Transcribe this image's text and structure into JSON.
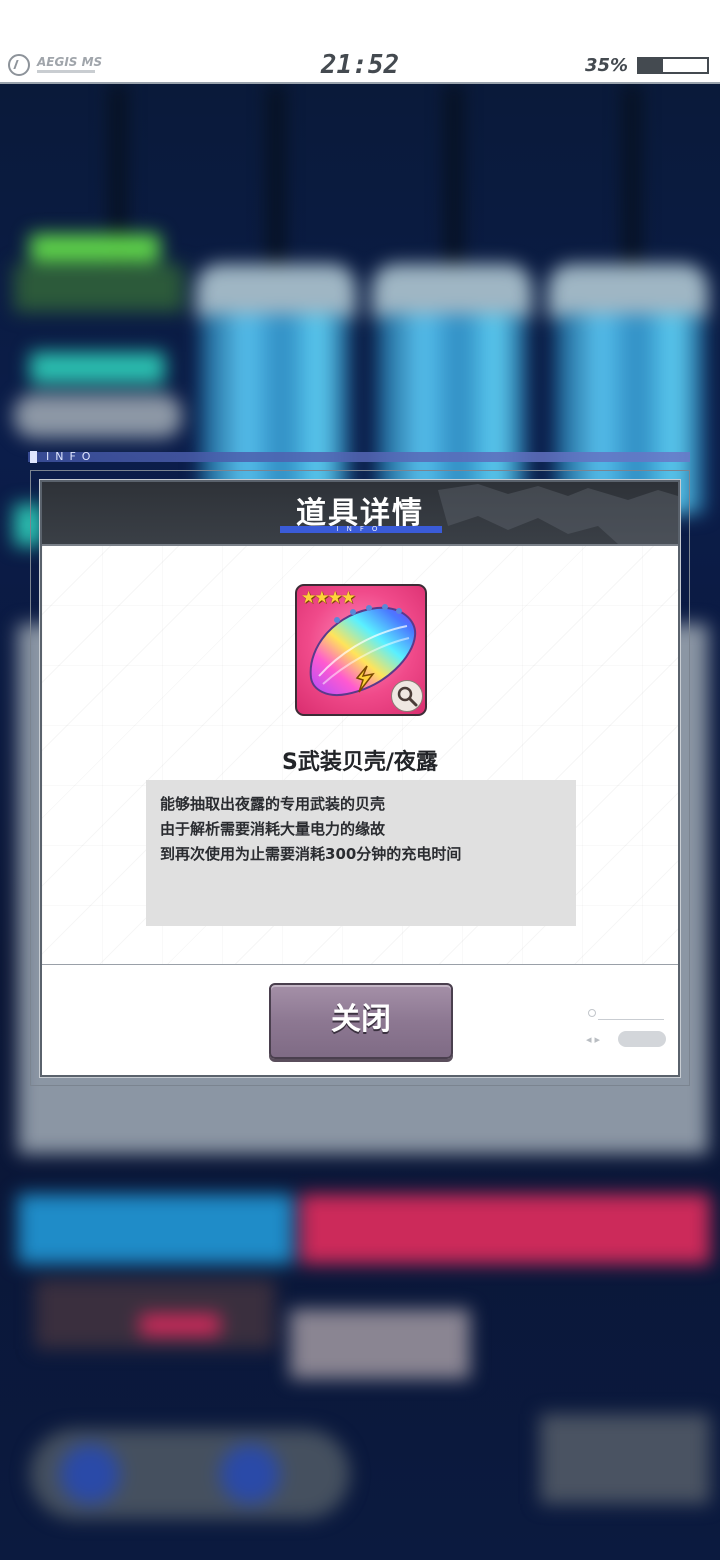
{
  "status_bar": {
    "brand": "AEGIS MS",
    "time": "21:52",
    "battery_percent_text": "35%",
    "battery_level": 0.35
  },
  "background": {
    "info_strip_label": "INFO"
  },
  "dialog": {
    "title": "道具详情",
    "title_sub": "INFO",
    "item": {
      "stars": "★★★★",
      "rarity": 4,
      "name": "S武装贝壳/夜露",
      "description_lines": [
        "能够抽取出夜露的专用武装的贝壳",
        "由于解析需要消耗大量电力的缘故",
        "到再次使用为止需要消耗300分钟的充电时间"
      ]
    },
    "close_button_label": "关闭"
  },
  "colors": {
    "header_bg": "#33373d",
    "title_accent": "#3a5bd8",
    "close_button": "#8d7892",
    "item_frame": "#f04a8a",
    "desc_bg": "#e0e0e0"
  },
  "icons": {
    "app_logo": "aegis-logo-icon",
    "battery": "battery-icon",
    "item_zoom": "magnifier-icon",
    "item_type": "lightning-icon"
  }
}
